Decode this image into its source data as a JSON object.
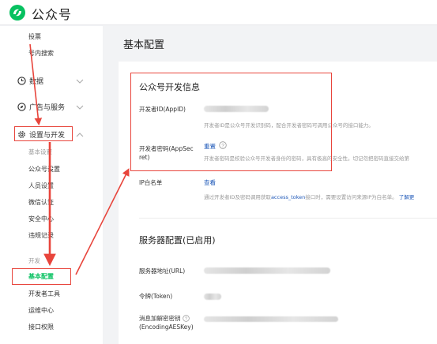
{
  "app": {
    "brand": "公众号"
  },
  "sidebar": {
    "top_items": [
      "投票",
      "号内搜索"
    ],
    "data_label": "数据",
    "ads_label": "广告与服务",
    "settings_label": "设置与开发",
    "settings_group_label": "基本设置",
    "settings_items": [
      "公众号设置",
      "人员设置",
      "微信认证",
      "安全中心",
      "违规记录"
    ],
    "dev_group_label": "开发",
    "dev_items": [
      "基本配置",
      "开发者工具",
      "运维中心",
      "接口权限"
    ]
  },
  "main": {
    "page_title": "基本配置",
    "dev_info": {
      "title": "公众号开发信息",
      "appid_label": "开发者ID(AppID)",
      "appid_hint": "开发者ID是公众号开发识别码，配合开发者密码可调用公众号的接口能力。",
      "secret_label": "开发者密码(AppSecret)",
      "secret_label_line1": "开发者密码(AppSec",
      "secret_label_line2": "ret)",
      "secret_reset": "重置",
      "secret_hint": "开发者密码是校验公众号开发者身份的密码，具有极高的安全性。切记勿把密码直接交给第",
      "ip_label": "IP白名单",
      "ip_view": "查看",
      "ip_hint_pre": "通过开发者ID及密码调用获取",
      "ip_hint_link": "access_token",
      "ip_hint_post": "接口时，需要设置访问来源IP为白名单。",
      "ip_learn_more": "了解更"
    },
    "server": {
      "title": "服务器配置(已启用)",
      "url_label": "服务器地址(URL)",
      "token_label": "令牌(Token)",
      "aes_label_line1": "消息加解密密钥",
      "aes_label_line2": "(EncodingAESKey)"
    }
  },
  "colors": {
    "accent_green": "#07c160",
    "annotation_red": "#e8453c",
    "link_blue": "#1e58b8"
  }
}
